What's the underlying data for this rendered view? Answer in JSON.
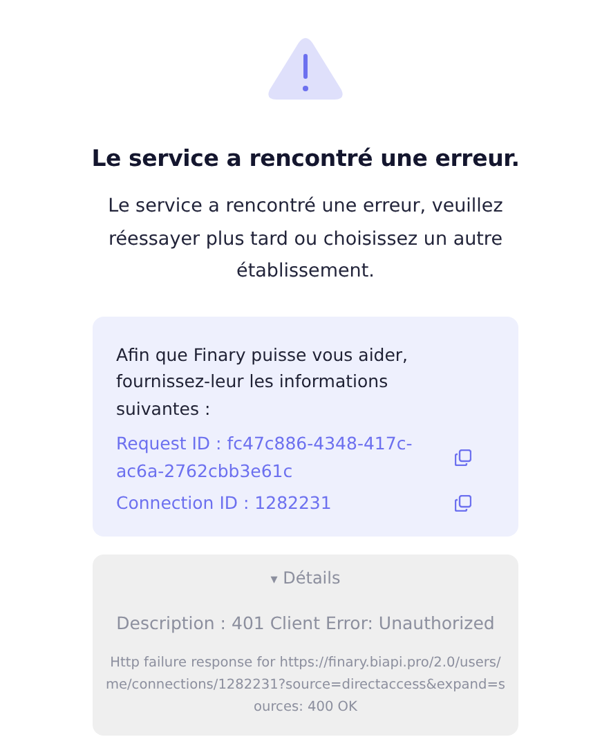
{
  "title": "Le service a rencontré une erreur.",
  "message": "Le service a rencontré une erreur, veuillez réessayer plus tard ou choisissez un autre établissement.",
  "help_card": {
    "intro": "Afin que Finary puisse vous aider, fournissez-leur les informations suivantes :",
    "ids": [
      {
        "text": "Request ID : fc47c886-4348-417c-ac6a-2762cbb3e61c"
      },
      {
        "text": "Connection ID : 1282231"
      }
    ]
  },
  "details": {
    "toggle_icon": "▾",
    "label": "Détails",
    "expanded": true,
    "description": "Description : 401 Client Error: Unauthorized",
    "error": "Http failure response for https://finary.biapi.pro/2.0/users/me/connections/1282231?source=directaccess&expand=sources: 400 OK"
  }
}
